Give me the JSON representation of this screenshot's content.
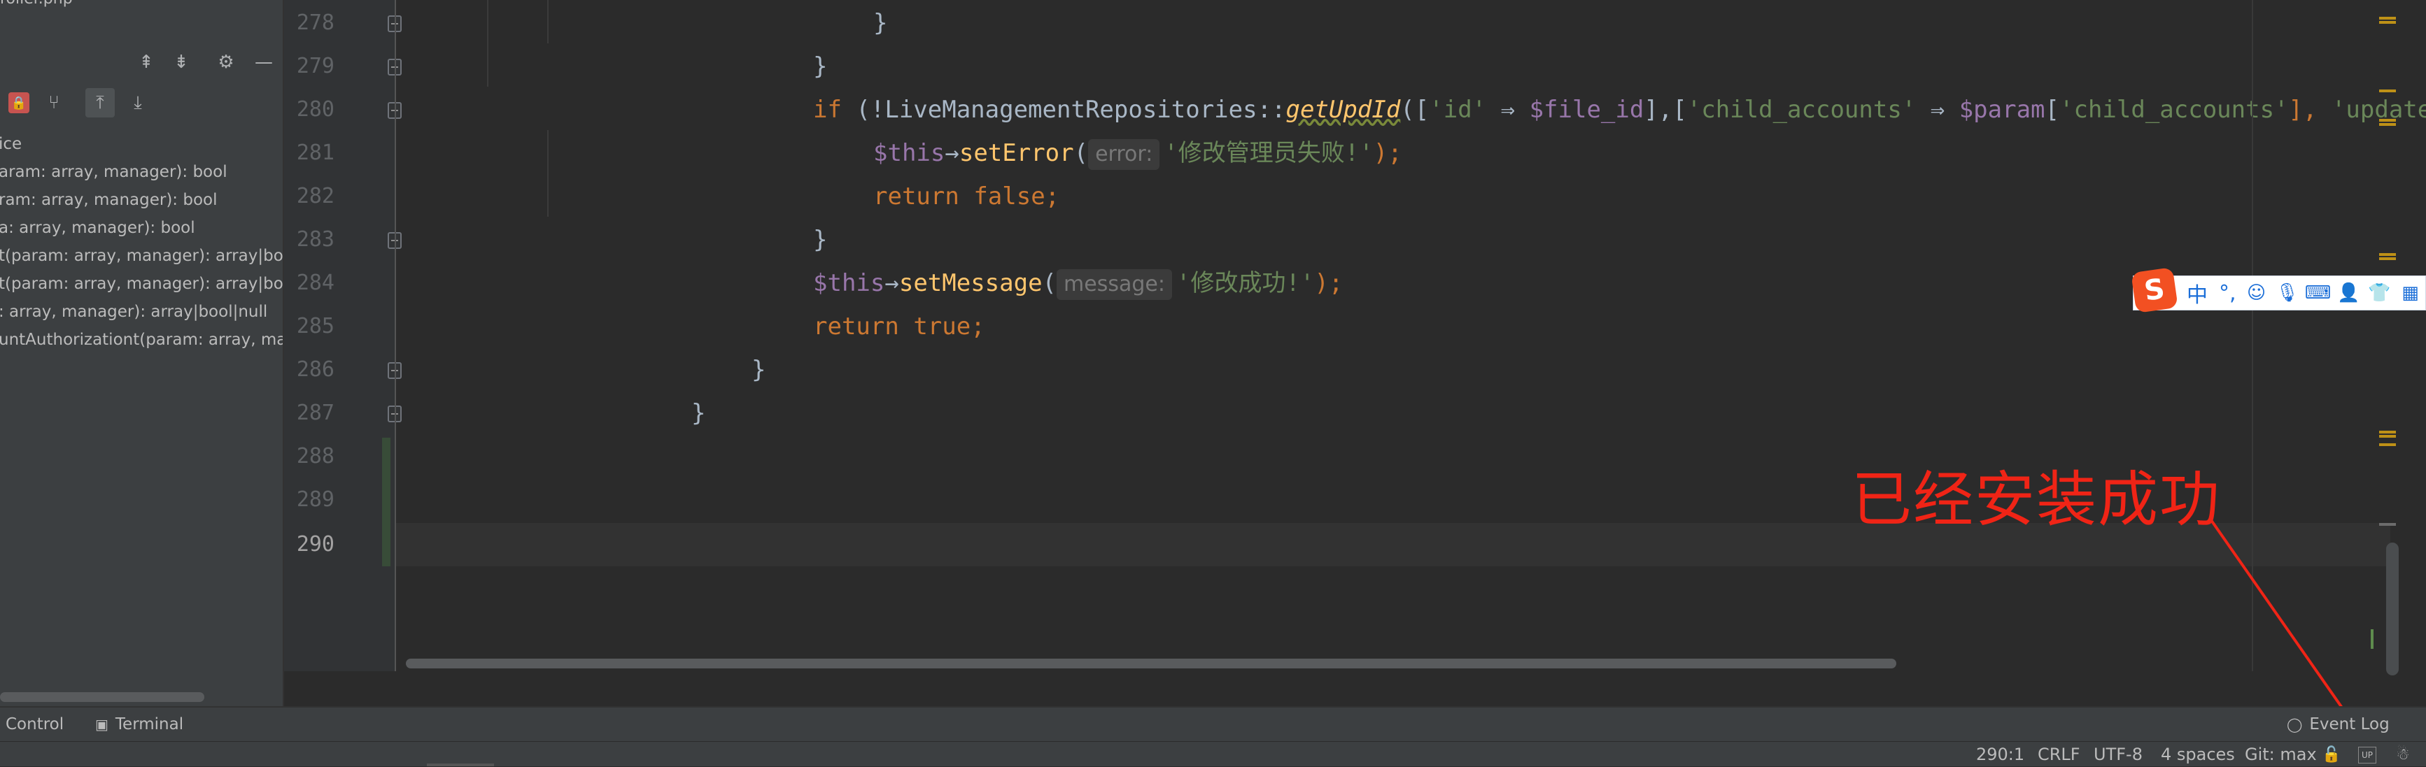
{
  "left_panel": {
    "file_name": "roller.php",
    "members": [
      "ice",
      "aram: array, manager): bool",
      "ram: array, manager): bool",
      "a: array, manager): bool",
      "t(param: array, manager): array|bool",
      "t(param: array, manager): array|bool",
      ": array, manager): array|bool|null",
      "untAuthorizationt(param: array, man"
    ]
  },
  "editor": {
    "line_numbers": [
      "278",
      "279",
      "280",
      "281",
      "282",
      "283",
      "284",
      "285",
      "286",
      "287",
      "288",
      "289",
      "290"
    ],
    "current_line": "290",
    "code": {
      "l278": "}",
      "l279": "}",
      "l280": {
        "kw_if": "if",
        "p1": " (!LiveManagementRepositories",
        "op": "::",
        "fn": "getUpdId",
        "p2": "([",
        "s1": "'id'",
        "arrow1": " ⇒ ",
        "v1": "$file_id",
        "p3": "],[",
        "s2": "'child_accounts'",
        "arrow2": " ⇒ ",
        "v2": "$param",
        "p4": "[",
        "s3": "'child_accounts'",
        "p5": "], ",
        "s4": "'updated_at'",
        "p6": " ="
      },
      "l281": {
        "var": "$this",
        "arrow": "→",
        "fn": "setError",
        "open": "(",
        "hint": "error:",
        "str": "'修改管理员失败!'",
        "close": ");"
      },
      "l282": {
        "kw_return": "return",
        "kw_false": "false",
        "semi": ";"
      },
      "l283": "}",
      "l284": {
        "var": "$this",
        "arrow": "→",
        "fn": "setMessage",
        "open": "(",
        "hint": "message:",
        "str": "'修改成功!'",
        "close": ");"
      },
      "l285": {
        "kw_return": "return",
        "kw_true": "true",
        "semi": ";"
      },
      "l286": "}",
      "l287": "}"
    }
  },
  "annotation": {
    "text": "已经安装成功",
    "color": "#f02416"
  },
  "ime_toolbar": {
    "logo": "S",
    "mode": "中",
    "punct": "°,"
  },
  "tool_windows": {
    "version_control": "Control",
    "terminal": "Terminal",
    "event_log": "Event Log"
  },
  "status_bar": {
    "position": "290:1",
    "line_sep": "CRLF",
    "encoding": "UTF-8",
    "indent": "4 spaces",
    "git": "Git: max"
  },
  "colors": {
    "keyword": "#cc7832",
    "variable": "#9876aa",
    "function": "#ffc66d",
    "string": "#6a8759",
    "text": "#a9b7c6",
    "background": "#2b2b2b"
  }
}
